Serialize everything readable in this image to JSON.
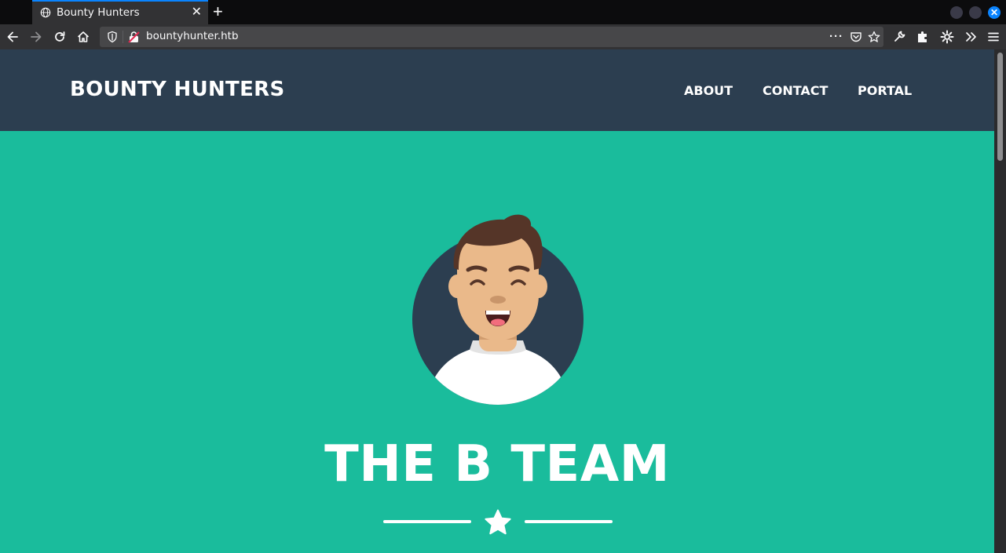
{
  "browser": {
    "tab_title": "Bounty Hunters",
    "url": "bountyhunter.htb",
    "tab_close_glyph": "✕",
    "new_tab_glyph": "+",
    "icons": [
      "globe-icon",
      "back-icon",
      "forward-icon",
      "reload-icon",
      "home-icon",
      "shield-icon",
      "insecure-lock-icon",
      "more-icon",
      "pocket-icon",
      "star-bookmark-icon",
      "wrench-icon",
      "extensions-icon",
      "gear-icon",
      "overflow-icon",
      "menu-icon",
      "window-close-icon"
    ]
  },
  "site": {
    "brand": "BOUNTY HUNTERS",
    "nav": [
      {
        "label": "ABOUT"
      },
      {
        "label": "CONTACT"
      },
      {
        "label": "PORTAL"
      }
    ],
    "masthead_title": "THE B TEAM",
    "divider_icon": "star-icon"
  },
  "colors": {
    "header_bg": "#2c3e50",
    "page_bg": "#1abc9c",
    "text": "#ffffff"
  }
}
